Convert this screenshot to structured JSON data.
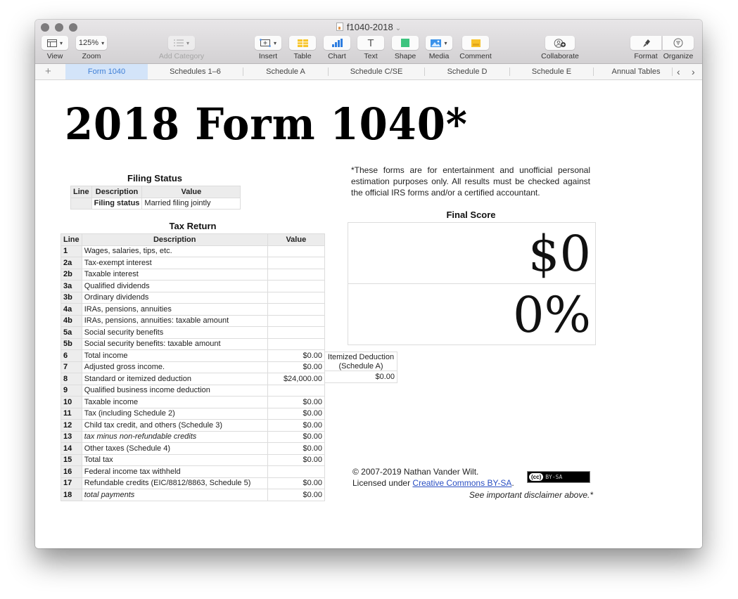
{
  "window": {
    "title": "f1040-2018",
    "title_chevron": "⌄"
  },
  "toolbar": {
    "view": {
      "label": "View",
      "icon": "sidebar-view-icon"
    },
    "zoom": {
      "label": "Zoom",
      "value": "125%"
    },
    "add_category": {
      "label": "Add Category",
      "icon": "list-icon"
    },
    "insert": {
      "label": "Insert",
      "icon": "insert-icon"
    },
    "table": {
      "label": "Table",
      "icon": "table-icon"
    },
    "chart": {
      "label": "Chart",
      "icon": "chart-icon"
    },
    "text": {
      "label": "Text",
      "icon": "text-icon",
      "glyph": "T"
    },
    "shape": {
      "label": "Shape",
      "icon": "shape-icon"
    },
    "media": {
      "label": "Media",
      "icon": "media-icon"
    },
    "comment": {
      "label": "Comment",
      "icon": "comment-icon"
    },
    "collaborate": {
      "label": "Collaborate",
      "icon": "collaborate-icon"
    },
    "format": {
      "label": "Format",
      "icon": "paintbrush-icon"
    },
    "organize": {
      "label": "Organize",
      "icon": "filter-icon"
    }
  },
  "tabs": {
    "add": "+",
    "items": [
      {
        "label": "Form 1040",
        "active": true
      },
      {
        "label": "Schedules 1–6"
      },
      {
        "label": "Schedule A"
      },
      {
        "label": "Schedule C/SE"
      },
      {
        "label": "Schedule D"
      },
      {
        "label": "Schedule E"
      },
      {
        "label": "Annual Tables"
      }
    ],
    "prev": "‹",
    "next": "›"
  },
  "page": {
    "title": "2018 Form 1040*",
    "disclaimer": "*These forms are for entertainment and unofficial personal estimation purposes only. All results must be checked against the official IRS forms and/or a certified accountant."
  },
  "filing_status": {
    "title": "Filing Status",
    "headers": [
      "Line",
      "Description",
      "Value"
    ],
    "row": {
      "line": "",
      "description": "Filing status",
      "value": "Married filing jointly"
    }
  },
  "tax_return": {
    "title": "Tax Return",
    "headers": [
      "Line",
      "Description",
      "Value"
    ],
    "rows": [
      {
        "line": "1",
        "description": "Wages, salaries, tips, etc.",
        "value": ""
      },
      {
        "line": "2a",
        "description": "Tax-exempt interest",
        "value": ""
      },
      {
        "line": "2b",
        "description": "Taxable interest",
        "value": ""
      },
      {
        "line": "3a",
        "description": "Qualified dividends",
        "value": ""
      },
      {
        "line": "3b",
        "description": "Ordinary dividends",
        "value": ""
      },
      {
        "line": "4a",
        "description": "IRAs, pensions, annuities",
        "value": ""
      },
      {
        "line": "4b",
        "description": "IRAs, pensions, annuities: taxable amount",
        "value": ""
      },
      {
        "line": "5a",
        "description": "Social security benefits",
        "value": ""
      },
      {
        "line": "5b",
        "description": "Social security benefits: taxable amount",
        "value": ""
      },
      {
        "line": "6",
        "description": "Total income",
        "value": "$0.00"
      },
      {
        "line": "7",
        "description": "Adjusted gross income.",
        "value": "$0.00"
      },
      {
        "line": "8",
        "description": "Standard or itemized deduction",
        "value": "$24,000.00"
      },
      {
        "line": "9",
        "description": "Qualified business income deduction",
        "value": ""
      },
      {
        "line": "10",
        "description": "Taxable income",
        "value": "$0.00"
      },
      {
        "line": "11",
        "description": "Tax (including Schedule 2)",
        "value": "$0.00"
      },
      {
        "line": "12",
        "description": "Child tax credit, and others (Schedule 3)",
        "value": "$0.00"
      },
      {
        "line": "13",
        "description": "tax minus non-refundable credits",
        "value": "$0.00",
        "italic": true
      },
      {
        "line": "14",
        "description": "Other taxes (Schedule 4)",
        "value": "$0.00"
      },
      {
        "line": "15",
        "description": "Total tax",
        "value": "$0.00"
      },
      {
        "line": "16",
        "description": "Federal income tax withheld",
        "value": ""
      },
      {
        "line": "17",
        "description": "Refundable credits (EIC/8812/8863, Schedule 5)",
        "value": "$0.00"
      },
      {
        "line": "18",
        "description": "total payments",
        "value": "$0.00",
        "italic": true
      }
    ]
  },
  "itemized": {
    "header_line1": "Itemized Deduction",
    "header_line2": "(Schedule A)",
    "value": "$0.00"
  },
  "final_score": {
    "title": "Final Score",
    "amount": "$0",
    "percent": "0%"
  },
  "footer": {
    "copyright": "© 2007-2019 Nathan Vander Wilt.",
    "licensed_prefix": "Licensed under ",
    "license_link": "Creative Commons BY-SA",
    "licensed_suffix": ".",
    "badge_cc": "(cc)",
    "badge_text": "BY-SA",
    "see_disclaimer": "See important disclaimer above.*"
  },
  "colors": {
    "active_tab_bg": "#d3e4f9",
    "active_tab_text": "#3f7fd6",
    "link": "#2a4fc3",
    "table_icon": "#f7c52b",
    "chart_icon": "#2f7ee0",
    "shape_icon": "#3ec47f",
    "comment_icon": "#f8c22a"
  }
}
